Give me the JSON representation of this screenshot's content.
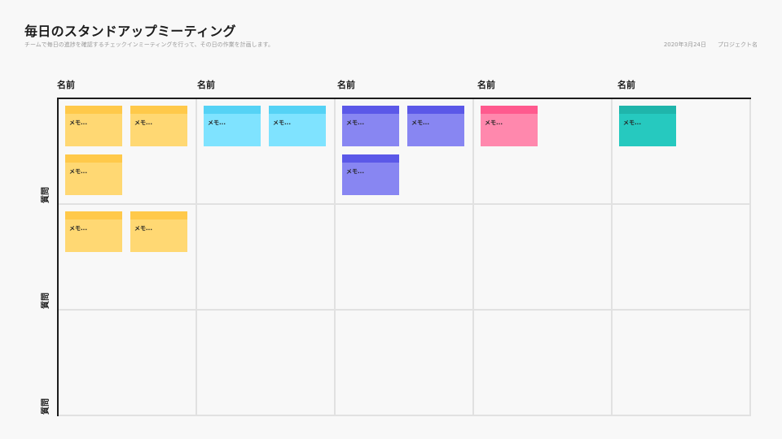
{
  "header": {
    "title": "毎日のスタンドアップミーティング",
    "subtitle": "チームで毎日の進捗を確認するチェックインミーティングを行って、その日の作業を計画します。",
    "date": "2020年3月24日",
    "project": "プロジェクト名"
  },
  "columns": [
    {
      "label": "名前"
    },
    {
      "label": "名前"
    },
    {
      "label": "名前"
    },
    {
      "label": "名前"
    },
    {
      "label": "名前"
    }
  ],
  "rows": [
    {
      "label": "質問"
    },
    {
      "label": "質問"
    },
    {
      "label": "質問"
    }
  ],
  "colors": {
    "yellow": {
      "body": "#ffd873",
      "band": "#ffc94a"
    },
    "cyan": {
      "body": "#7fe3ff",
      "band": "#55d2f5"
    },
    "indigo": {
      "body": "#8886f2",
      "band": "#5b58e8"
    },
    "pink": {
      "body": "#ff88ad",
      "band": "#ff5a8e"
    },
    "teal": {
      "body": "#26c9bf",
      "band": "#1fb5ab"
    }
  },
  "notes": [
    {
      "row": 0,
      "col": 0,
      "slot": 0,
      "color": "yellow",
      "text": "メモ..."
    },
    {
      "row": 0,
      "col": 0,
      "slot": 1,
      "color": "yellow",
      "text": "メモ..."
    },
    {
      "row": 0,
      "col": 0,
      "slot": 2,
      "color": "yellow",
      "text": "メモ..."
    },
    {
      "row": 0,
      "col": 1,
      "slot": 0,
      "color": "cyan",
      "text": "メモ..."
    },
    {
      "row": 0,
      "col": 1,
      "slot": 1,
      "color": "cyan",
      "text": "メモ..."
    },
    {
      "row": 0,
      "col": 2,
      "slot": 0,
      "color": "indigo",
      "text": "メモ..."
    },
    {
      "row": 0,
      "col": 2,
      "slot": 1,
      "color": "indigo",
      "text": "メモ..."
    },
    {
      "row": 0,
      "col": 2,
      "slot": 2,
      "color": "indigo",
      "text": "メモ..."
    },
    {
      "row": 0,
      "col": 3,
      "slot": 0,
      "color": "pink",
      "text": "メモ..."
    },
    {
      "row": 0,
      "col": 4,
      "slot": 0,
      "color": "teal",
      "text": "メモ..."
    },
    {
      "row": 1,
      "col": 0,
      "slot": 0,
      "color": "yellow",
      "text": "メモ..."
    },
    {
      "row": 1,
      "col": 0,
      "slot": 1,
      "color": "yellow",
      "text": "メモ..."
    }
  ]
}
